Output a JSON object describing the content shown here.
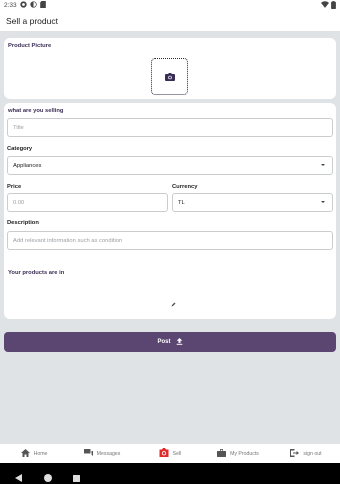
{
  "status_bar": {
    "time": "2:33"
  },
  "app_bar": {
    "title": "Sell a product"
  },
  "picture_card": {
    "title": "Product Picture"
  },
  "form": {
    "section_title": "what are you selling",
    "title_placeholder": "Title",
    "category_label": "Category",
    "category_value": "Appliances",
    "price_label": "Price",
    "price_placeholder": "0.00",
    "currency_label": "Currency",
    "currency_value": "TL",
    "description_label": "Description",
    "description_placeholder": "Add relevant information such as condition"
  },
  "location_card": {
    "title": "Your products are in"
  },
  "post_button": {
    "label": "Post"
  },
  "bottom_nav": {
    "items": [
      {
        "label": "Home",
        "icon": "home-icon"
      },
      {
        "label": "Messages",
        "icon": "messages-icon"
      },
      {
        "label": "Sell",
        "icon": "sell-camera-icon"
      },
      {
        "label": "My Products",
        "icon": "my-products-icon"
      },
      {
        "label": "sign out",
        "icon": "sign-out-icon"
      }
    ]
  },
  "colors": {
    "accent": "#5a4670",
    "title_purple": "#3a2d55",
    "sell_icon": "#e02b2b",
    "background": "#dfe3e6"
  }
}
